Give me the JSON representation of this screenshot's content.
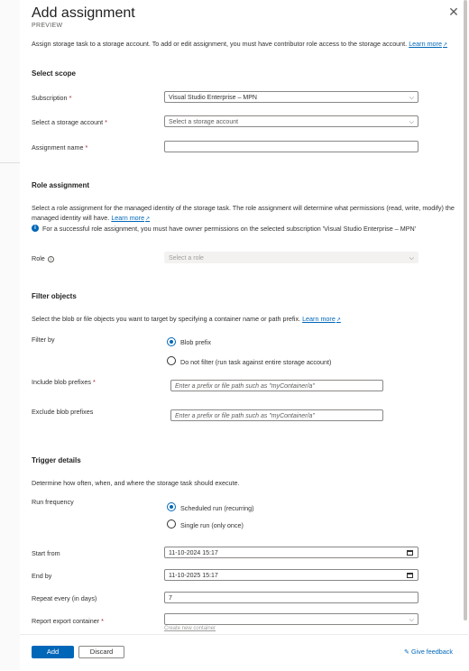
{
  "header": {
    "title": "Add assignment",
    "subtitle": "PREVIEW",
    "close_icon": "close-icon"
  },
  "intro": {
    "text": "Assign storage task to a storage account. To add or edit assignment, you must have contributor role access to the storage account.",
    "link": "Learn more"
  },
  "scope": {
    "heading": "Select scope",
    "subscription_label": "Subscription",
    "subscription_value": "Visual Studio Enterprise – MPN",
    "storage_label": "Select a storage account",
    "storage_placeholder": "Select a storage account",
    "name_label": "Assignment name",
    "name_value": ""
  },
  "role": {
    "heading": "Role assignment",
    "text": "Select a role assignment for the managed identity of the storage task. The role assignment will determine what permissions (read, write, modify) the managed identity will have.",
    "link": "Learn more",
    "info_text": "For a successful role assignment, you must have owner permissions on the selected subscription 'Visual Studio Enterprise – MPN'",
    "role_label": "Role",
    "role_placeholder": "Select a role"
  },
  "filter": {
    "heading": "Filter objects",
    "text": "Select the blob or file objects you want to target by specifying a container name or path prefix.",
    "link": "Learn more",
    "filter_by_label": "Filter by",
    "options": [
      "Blob prefix",
      "Do not filter (run task against entire storage account)"
    ],
    "selected": "Blob prefix",
    "include_label": "Include blob prefixes",
    "include_placeholder": "Enter a prefix or file path such as \"myContainer/a\"",
    "exclude_label": "Exclude blob prefixes",
    "exclude_placeholder": "Enter a prefix or file path such as \"myContainer/a\""
  },
  "trigger": {
    "heading": "Trigger details",
    "text": "Determine how often, when, and where the storage task should execute.",
    "run_label": "Run frequency",
    "options": [
      "Scheduled run (recurring)",
      "Single run (only once)"
    ],
    "selected": "Scheduled run (recurring)",
    "start_label": "Start from",
    "start_value": "11-10-2024 15:17",
    "end_label": "End by",
    "end_value": "11-10-2025 15:17",
    "repeat_label": "Repeat every (in days)",
    "repeat_value": "7",
    "container_label": "Report export container",
    "container_value": "",
    "create_new_link": "Create new container"
  },
  "footer": {
    "add_label": "Add",
    "discard_label": "Discard",
    "feedback_label": "Give feedback"
  }
}
